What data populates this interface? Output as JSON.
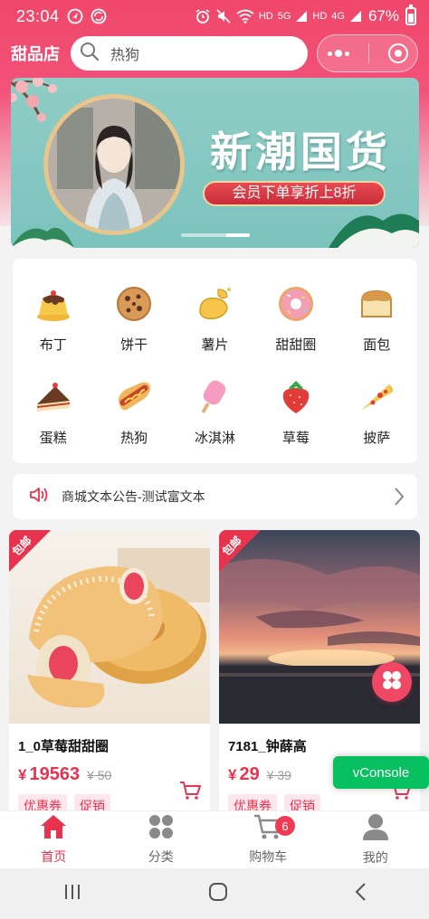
{
  "status_bar": {
    "time": "23:04",
    "net_hd1": "HD",
    "net_5g": "5G",
    "net_hd2": "HD",
    "net_4g": "4G",
    "battery": "67%"
  },
  "header": {
    "shop_name": "甜品店",
    "search_placeholder": "热狗"
  },
  "banner": {
    "headline": "新潮国货",
    "tagline": "会员下单享折上8折"
  },
  "categories": [
    {
      "label": "布丁",
      "icon": "pudding-icon"
    },
    {
      "label": "饼干",
      "icon": "cookie-icon"
    },
    {
      "label": "薯片",
      "icon": "chips-icon"
    },
    {
      "label": "甜甜圈",
      "icon": "donut-icon"
    },
    {
      "label": "面包",
      "icon": "bread-icon"
    },
    {
      "label": "蛋糕",
      "icon": "cake-icon"
    },
    {
      "label": "热狗",
      "icon": "hotdog-icon"
    },
    {
      "label": "冰淇淋",
      "icon": "ice-cream-icon"
    },
    {
      "label": "草莓",
      "icon": "strawberry-icon"
    },
    {
      "label": "披萨",
      "icon": "pizza-icon"
    }
  ],
  "notice": {
    "text": "商城文本公告-测试富文本"
  },
  "products": [
    {
      "badge": "包邮",
      "name": "1_0草莓甜甜圈",
      "currency": "¥",
      "price": "19563",
      "old_price": "¥ 50",
      "tags": [
        "优惠券",
        "促销"
      ]
    },
    {
      "badge": "包邮",
      "name": "7181_钟薛高",
      "currency": "¥",
      "price": "29",
      "old_price": "¥ 39",
      "tags": [
        "优惠券",
        "促销"
      ]
    }
  ],
  "vconsole": "vConsole",
  "tab_bar": {
    "items": [
      {
        "label": "首页",
        "active": true
      },
      {
        "label": "分类",
        "active": false
      },
      {
        "label": "购物车",
        "active": false
      },
      {
        "label": "我的",
        "active": false
      }
    ],
    "cart_badge": "6"
  },
  "colors": {
    "brand": "#f0476a",
    "price": "#e8334f",
    "vconsole": "#07c160"
  }
}
